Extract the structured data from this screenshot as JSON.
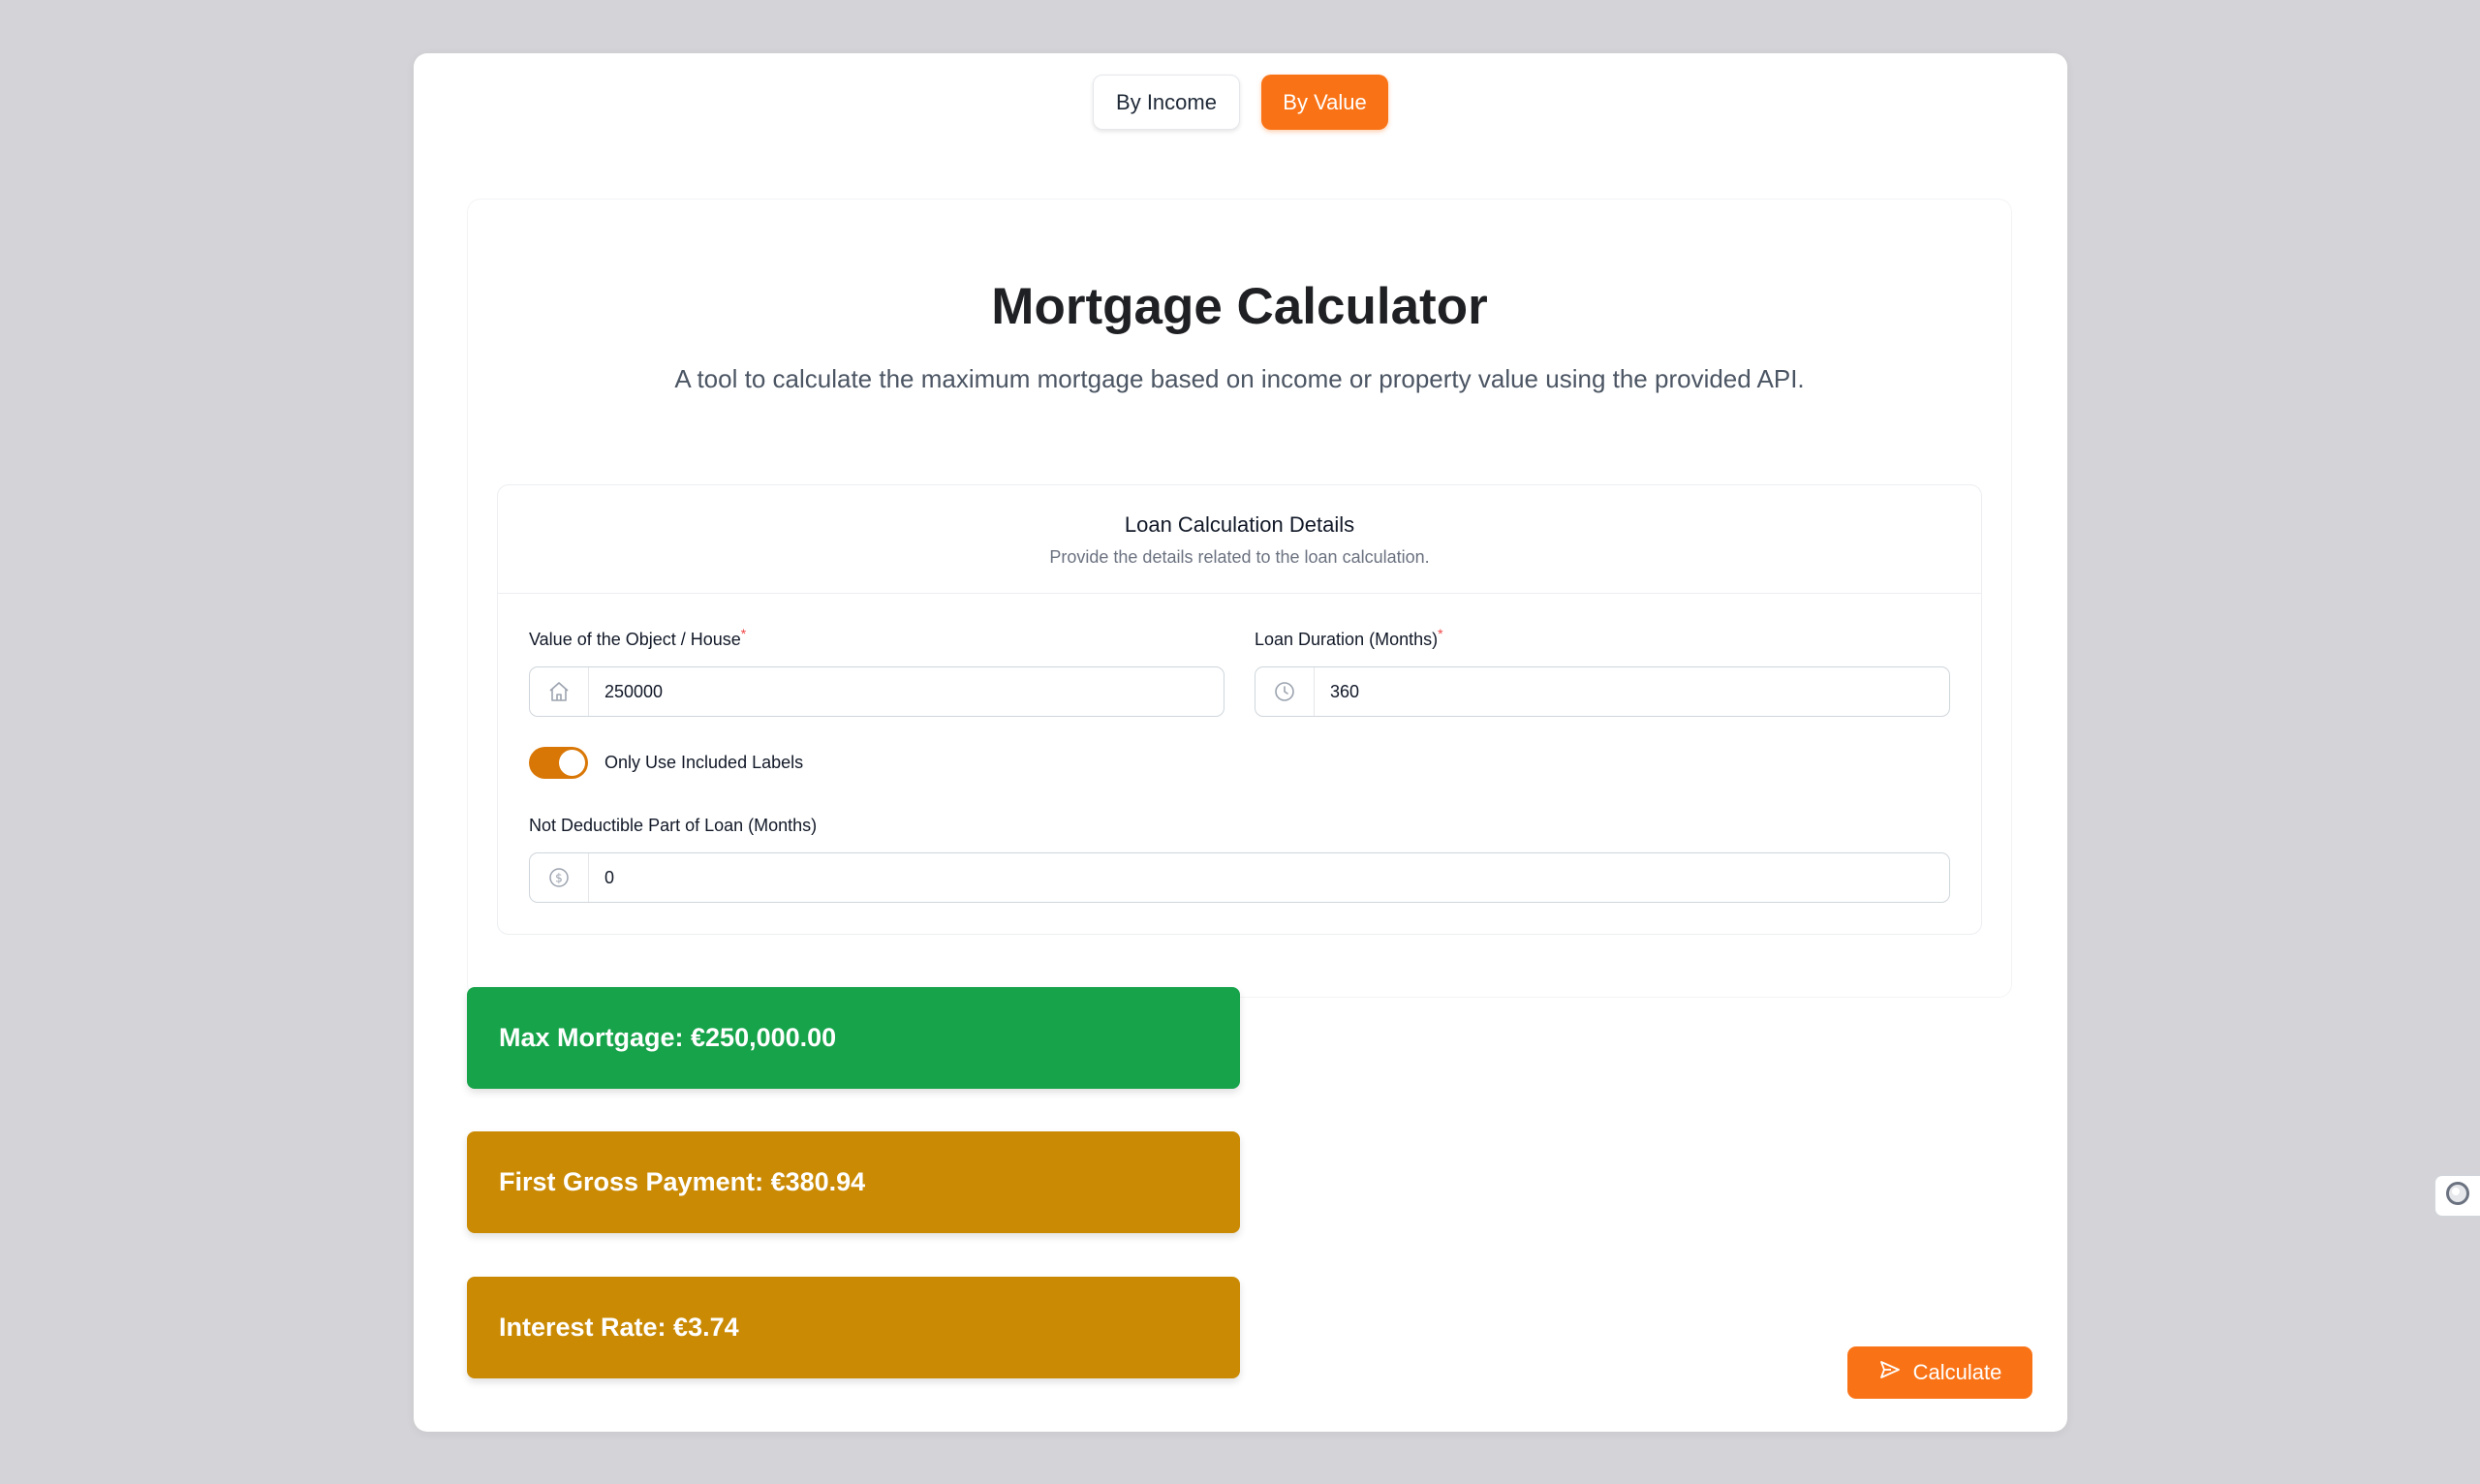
{
  "mode_tabs": [
    {
      "label": "By Income",
      "active": false
    },
    {
      "label": "By Value",
      "active": true
    }
  ],
  "header": {
    "title": "Mortgage Calculator",
    "subtitle": "A tool to calculate the maximum mortgage based on income or property value using the provided API."
  },
  "details": {
    "title": "Loan Calculation Details",
    "description": "Provide the details related to the loan calculation."
  },
  "fields": {
    "object_value": {
      "label": "Value of the Object / House",
      "required_mark": "*",
      "value": "250000",
      "icon": "home-icon"
    },
    "loan_duration": {
      "label": "Loan Duration (Months)",
      "required_mark": "*",
      "value": "360",
      "icon": "clock-icon"
    },
    "included_labels": {
      "label": "Only Use Included Labels",
      "checked": true
    },
    "not_deductible": {
      "label": "Not Deductible Part of Loan (Months)",
      "value": "0",
      "icon": "dollar-circle-icon"
    }
  },
  "results": {
    "max_mortgage": "Max Mortgage: €250,000.00",
    "first_gross_payment": "First Gross Payment: €380.94",
    "interest_rate": "Interest Rate: €3.74"
  },
  "actions": {
    "calculate_label": "Calculate",
    "calculate_icon": "send-icon"
  },
  "colors": {
    "accent": "#f97316",
    "toggle": "#d97706",
    "success": "#16a34a",
    "warning": "#ca8a04",
    "background": "#d4d4d8"
  }
}
